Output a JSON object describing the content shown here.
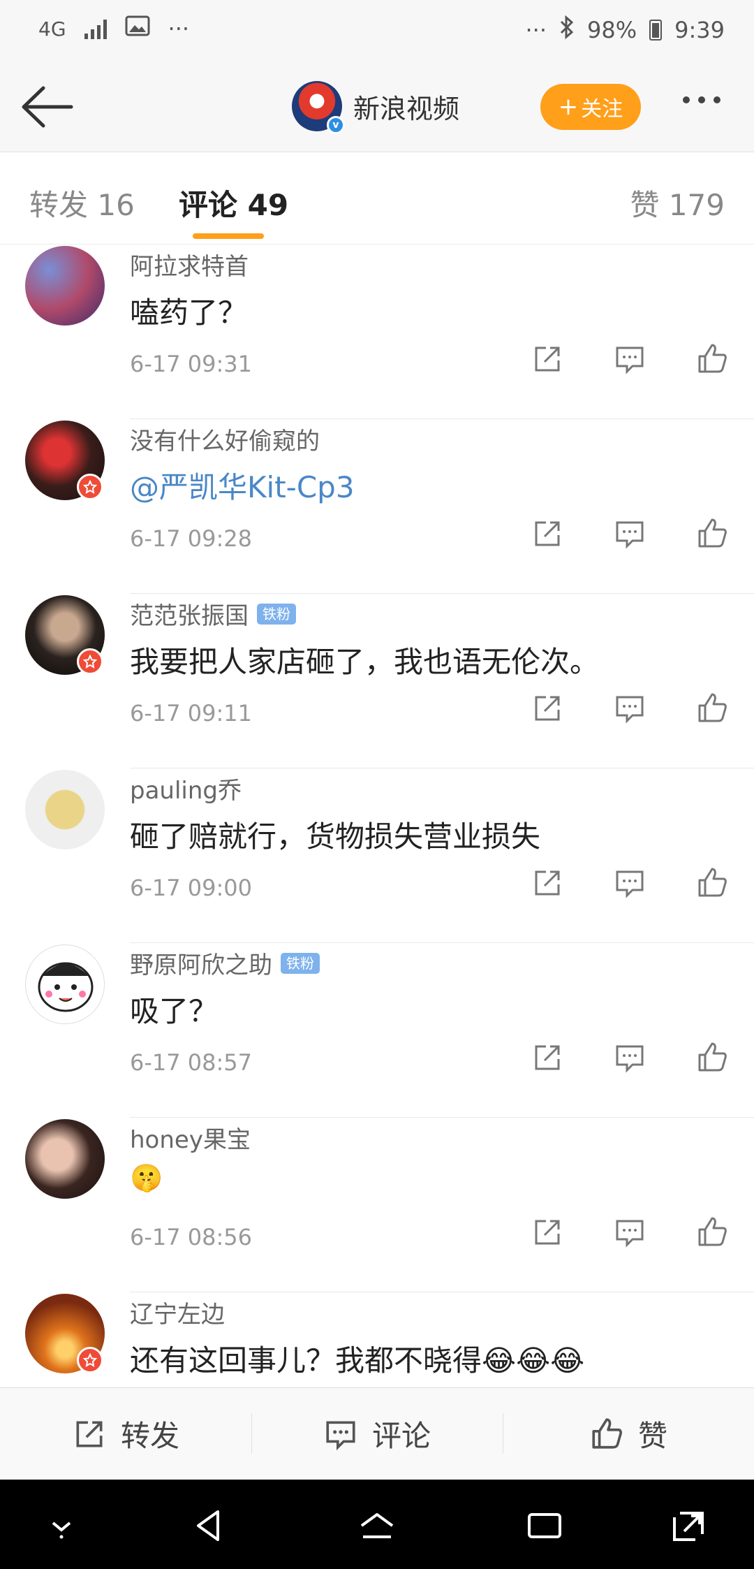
{
  "status_bar": {
    "network": "4G",
    "more_left": "···",
    "more_right": "···",
    "battery": "98%",
    "time": "9:39"
  },
  "header": {
    "account_name": "新浪视频",
    "follow_label": "关注",
    "follow_plus": "+"
  },
  "tabs": {
    "repost": "转发 16",
    "comments": "评论 49",
    "likes": "赞 179"
  },
  "comments": [
    {
      "user": "阿拉求特首",
      "text": "嗑药了？",
      "time": "6-17 09:31",
      "badge": "",
      "mention": false
    },
    {
      "user": "没有什么好偷窥的",
      "text": "@严凯华Kit-Cp3",
      "time": "6-17 09:28",
      "badge": "",
      "mention": true
    },
    {
      "user": "范范张振国",
      "text": "我要把人家店砸了，我也语无伦次。",
      "time": "6-17 09:11",
      "badge": "铁粉",
      "mention": false
    },
    {
      "user": "pauling乔",
      "text": "砸了赔就行，货物损失营业损失",
      "time": "6-17 09:00",
      "badge": "",
      "mention": false
    },
    {
      "user": "野原阿欣之助",
      "text": "吸了？",
      "time": "6-17 08:57",
      "badge": "铁粉",
      "mention": false
    },
    {
      "user": "honey果宝",
      "text": "🤫",
      "time": "6-17 08:56",
      "badge": "",
      "mention": false
    },
    {
      "user": "辽宁左边",
      "text": "还有这回事儿？我都不晓得😂😂😂",
      "time": "",
      "badge": "",
      "mention": false
    }
  ],
  "toolbar": {
    "repost": "转发",
    "comment": "评论",
    "like": "赞"
  },
  "colors": {
    "accent": "#ff9f1a",
    "mention": "#4a87c7",
    "badge": "#7fb2ec"
  }
}
